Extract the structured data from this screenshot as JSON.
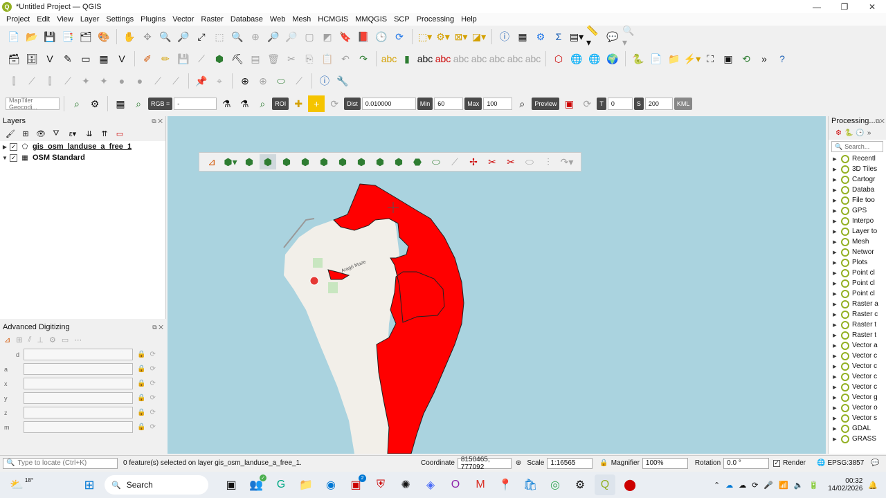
{
  "window": {
    "title": "*Untitled Project — QGIS",
    "logo_letter": "Q",
    "minimize": "—",
    "maximize": "❐",
    "close": "✕"
  },
  "menu": [
    "Project",
    "Edit",
    "View",
    "Layer",
    "Settings",
    "Plugins",
    "Vector",
    "Raster",
    "Database",
    "Web",
    "Mesh",
    "HCMGIS",
    "MMQGIS",
    "SCP",
    "Processing",
    "Help"
  ],
  "toolbar4": {
    "geocoder_placeholder": "MapTiler Geocodi...",
    "rgb_label": "RGB =",
    "rgb_value": "-",
    "roi_label": "ROI",
    "dist_label": "Dist",
    "dist_value": "0.010000",
    "min_label": "Min",
    "min_value": "60",
    "max_label": "Max",
    "max_value": "100",
    "preview_label": "Preview",
    "t_label": "T",
    "t_value": "0",
    "s_label": "S",
    "s_value": "200",
    "kml_label": "KML"
  },
  "layers_panel": {
    "title": "Layers",
    "items": [
      {
        "name": "gis_osm_landuse_a_free_1",
        "checked": true,
        "icon": "polygon-layer-icon"
      },
      {
        "name": "OSM Standard",
        "checked": true,
        "icon": "xyz-tile-icon"
      }
    ]
  },
  "advanced_digitizing": {
    "title": "Advanced Digitizing",
    "fields": [
      "d",
      "a",
      "x",
      "y",
      "z",
      "m"
    ]
  },
  "processing_panel": {
    "title": "Processing...",
    "search_placeholder": "Search...",
    "items": [
      "Recentl",
      "3D Tiles",
      "Cartogr",
      "Databa",
      "File too",
      "GPS",
      "Interpo",
      "Layer to",
      "Mesh",
      "Networ",
      "Plots",
      "Point cl",
      "Point cl",
      "Point cl",
      "Raster a",
      "Raster c",
      "Raster t",
      "Raster t",
      "Vector a",
      "Vector c",
      "Vector c",
      "Vector c",
      "Vector c",
      "Vector g",
      "Vector o",
      "Vector s",
      "GDAL",
      "GRASS"
    ]
  },
  "map": {
    "street_label": "Aragó Maze",
    "water_color": "#aad3df",
    "land_color": "#f2efe9",
    "landuse_color": "#ff0000"
  },
  "statusbar": {
    "locate_placeholder": "Type to locate (Ctrl+K)",
    "message": "0 feature(s) selected on layer gis_osm_landuse_a_free_1.",
    "coordinate_label": "Coordinate",
    "coordinate_value": "8150465, 777092",
    "scale_label": "Scale",
    "scale_value": "1:16565",
    "magnifier_label": "Magnifier",
    "magnifier_value": "100%",
    "rotation_label": "Rotation",
    "rotation_value": "0.0 °",
    "render_label": "Render",
    "crs": "EPSG:3857"
  },
  "taskbar": {
    "weather": "18°",
    "search_label": "Search",
    "time": "00:32",
    "date": "14/02/2026",
    "teams_badge": "2"
  }
}
